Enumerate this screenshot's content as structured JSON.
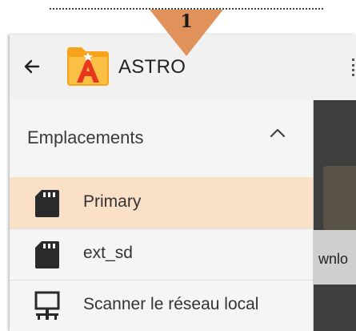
{
  "annotation": {
    "callout_number": "1",
    "callout_color": "#e0925a"
  },
  "appbar": {
    "back_icon": "arrow-left-icon",
    "app_icon": "astro-folder-icon",
    "title": "ASTRO",
    "overflow_icon": "more-vert-icon"
  },
  "drawer": {
    "section_label": "Emplacements",
    "section_toggle_icon": "chevron-up-icon",
    "items": [
      {
        "label": "Primary",
        "icon": "sd-card-icon",
        "selected": true
      },
      {
        "label": "ext_sd",
        "icon": "sd-card-icon",
        "selected": false
      },
      {
        "label": "Scanner le réseau local",
        "icon": "network-computer-icon",
        "selected": false
      }
    ]
  },
  "background_content": {
    "partial_text": "wnlo"
  },
  "colors": {
    "selected_item_bg": "#fbe0c8",
    "appbar_bg": "#f1f1f1",
    "drawer_bg": "#f5f5f5",
    "accent_orange": "#f39a1d"
  }
}
